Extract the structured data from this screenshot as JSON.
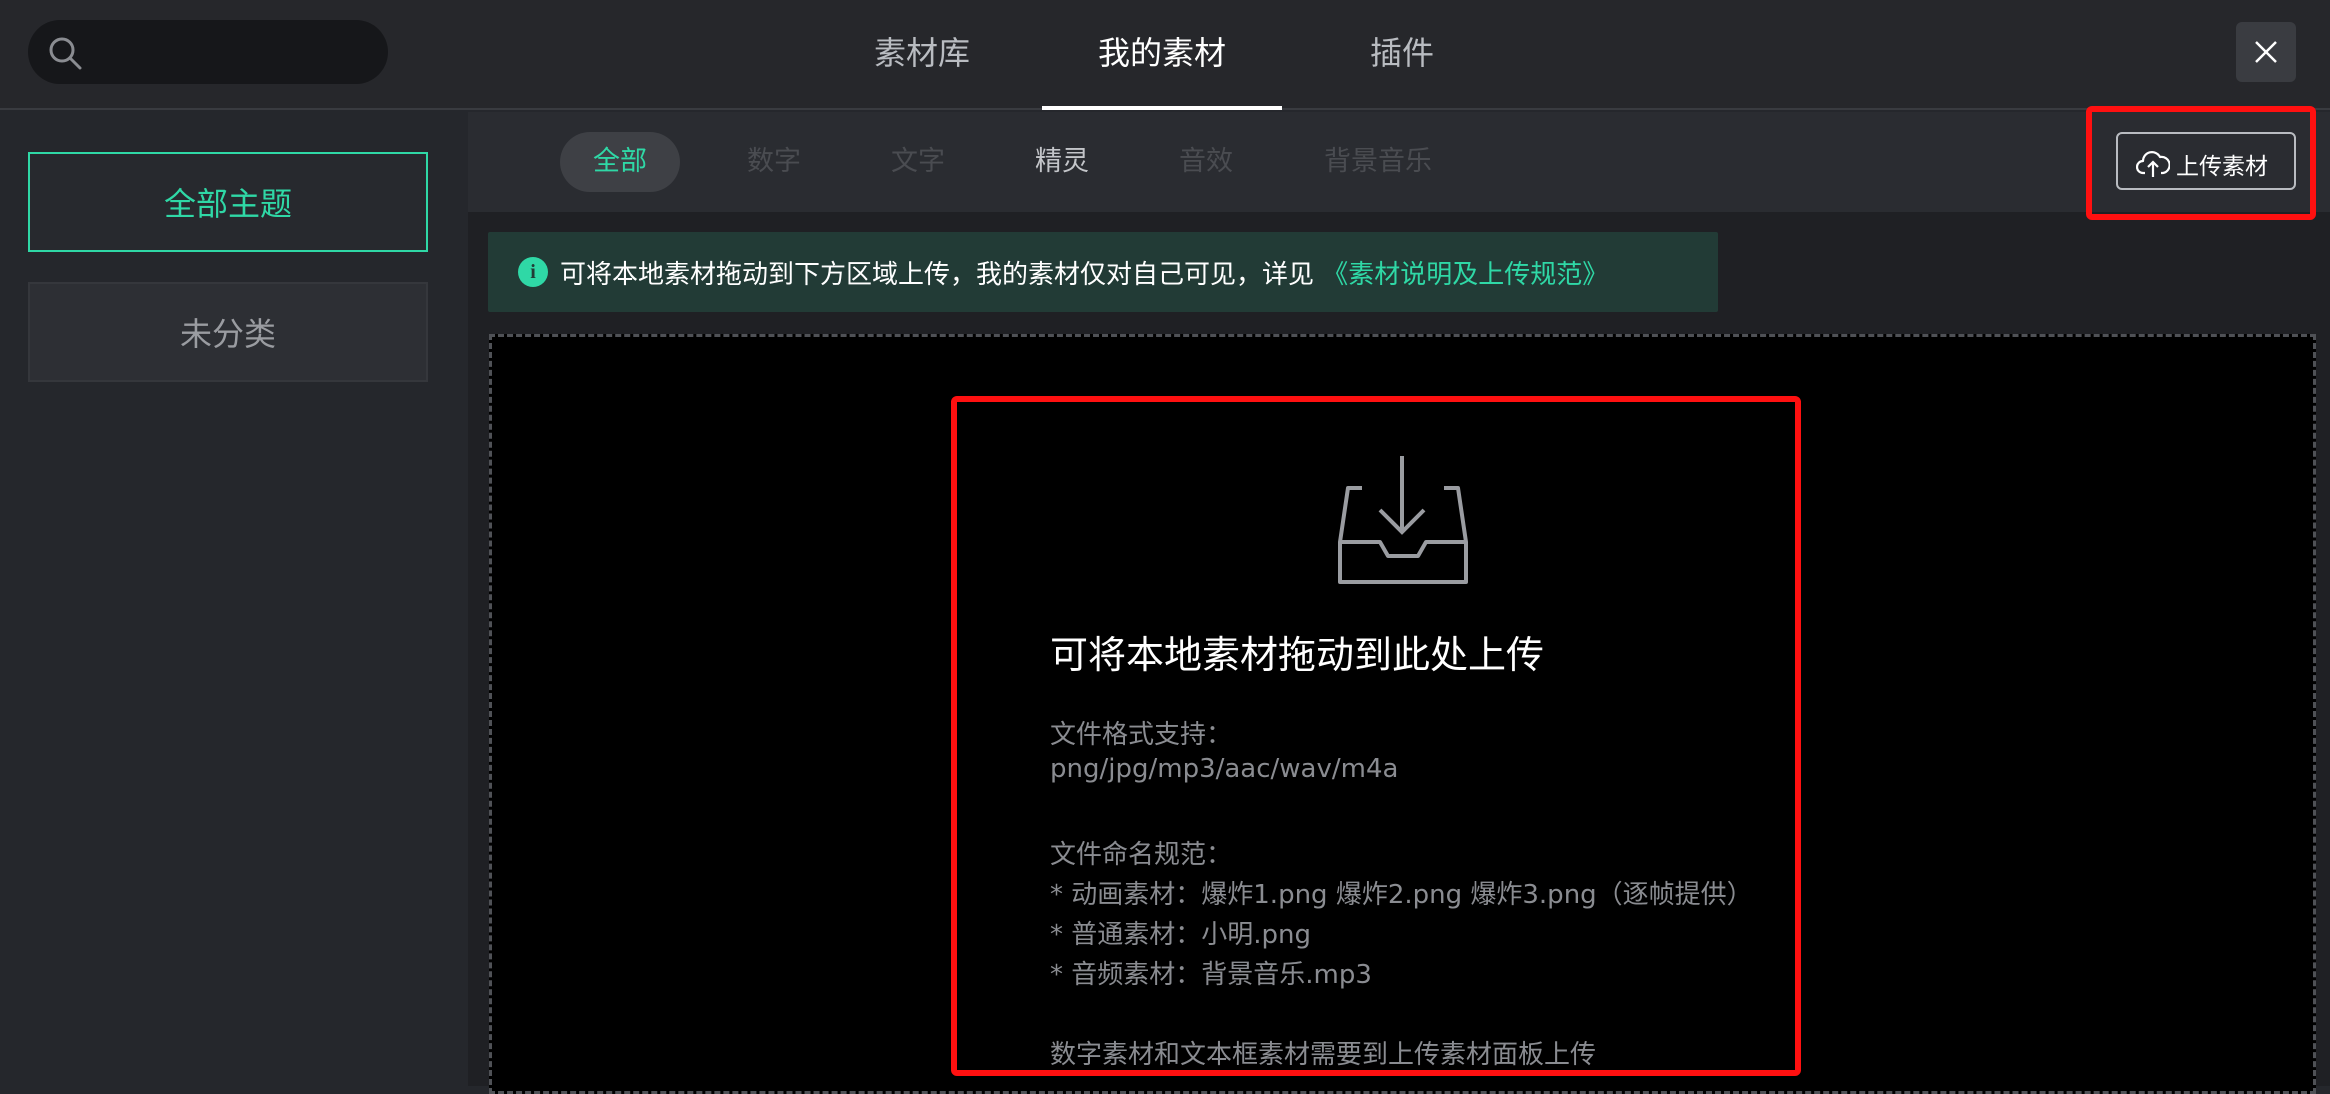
{
  "header": {
    "search_placeholder": "",
    "tabs": [
      {
        "label": "素材库"
      },
      {
        "label": "我的素材"
      },
      {
        "label": "插件"
      }
    ]
  },
  "sidebar": {
    "items": [
      {
        "label": "全部主题"
      },
      {
        "label": "未分类"
      }
    ]
  },
  "subtabs": [
    {
      "label": "全部"
    },
    {
      "label": "数字"
    },
    {
      "label": "文字"
    },
    {
      "label": "精灵"
    },
    {
      "label": "音效"
    },
    {
      "label": "背景音乐"
    }
  ],
  "upload_button": {
    "label": "上传素材"
  },
  "notice": {
    "text": "可将本地素材拖动到下方区域上传，我的素材仅对自己可见，详见",
    "link": "《素材说明及上传规范》"
  },
  "dropzone": {
    "title": "可将本地素材拖动到此处上传",
    "format_label": "文件格式支持：",
    "formats": "png/jpg/mp3/aac/wav/m4a",
    "naming_label": "文件命名规范：",
    "naming_rules": [
      "* 动画素材：爆炸1.png 爆炸2.png 爆炸3.png（逐帧提供）",
      "* 普通素材：小明.png",
      "* 音频素材：背景音乐.mp3"
    ],
    "footer": "数字素材和文本框素材需要到上传素材面板上传"
  },
  "colors": {
    "accent": "#2fd8a6",
    "highlight": "#ff1010",
    "background": "#25272c"
  },
  "icons": [
    "search-icon",
    "close-icon",
    "upload-cloud-icon",
    "info-icon",
    "inbox-download-icon"
  ]
}
